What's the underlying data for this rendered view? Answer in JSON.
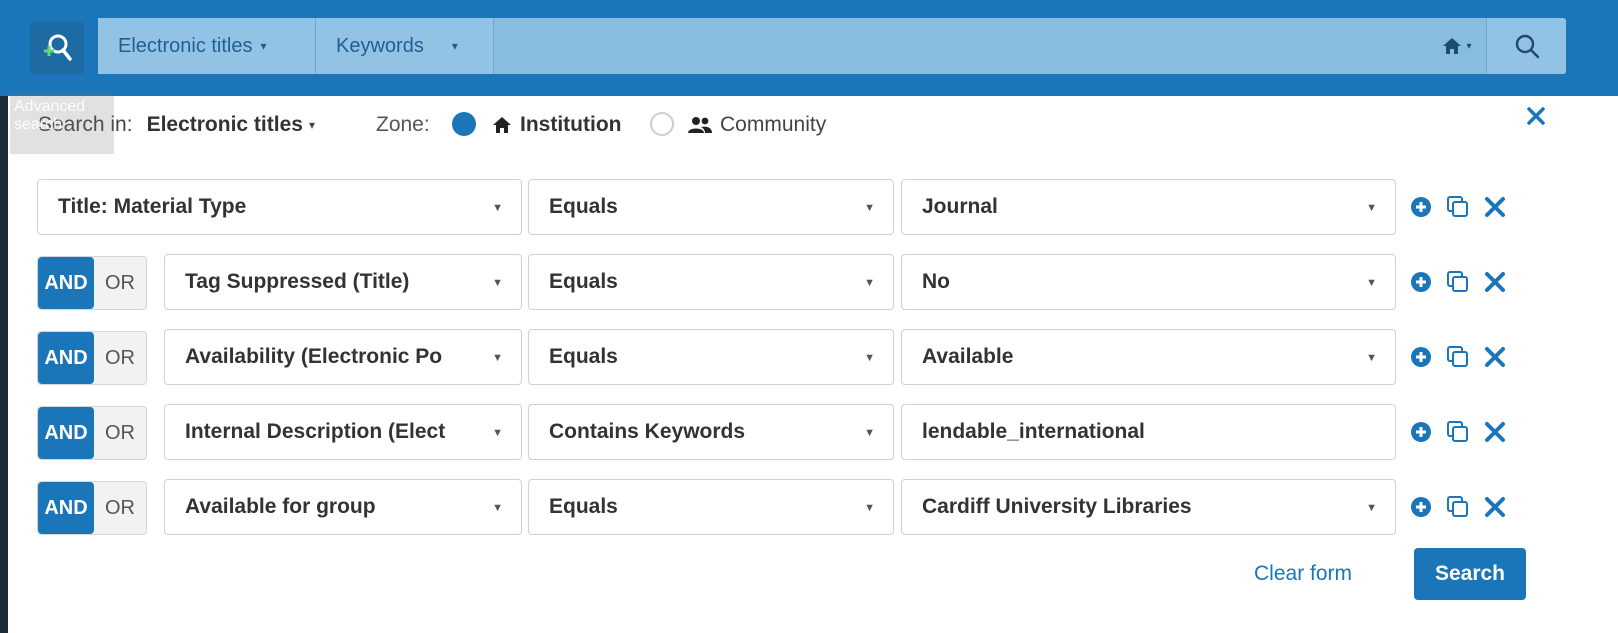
{
  "header": {
    "tooltip": "Advanced search",
    "search_type": "Electronic titles",
    "search_field": "Keywords",
    "search_type_caret": "▾",
    "search_field_caret": "▾",
    "home_caret": "▾"
  },
  "panel": {
    "search_in_label": "Search in:",
    "search_in_value": "Electronic titles",
    "zone_label": "Zone:",
    "zone_institution": "Institution",
    "zone_community": "Community",
    "zone_selected": "Institution"
  },
  "rows": [
    {
      "conj": "",
      "field": "Title: Material Type",
      "operator": "Equals",
      "value": "Journal",
      "value_dropdown": true
    },
    {
      "conj": "AND",
      "field": "Tag Suppressed (Title)",
      "operator": "Equals",
      "value": "No",
      "value_dropdown": true
    },
    {
      "conj": "AND",
      "field": "Availability (Electronic Po",
      "operator": "Equals",
      "value": "Available",
      "value_dropdown": true
    },
    {
      "conj": "AND",
      "field": "Internal Description (Elect",
      "operator": "Contains Keywords",
      "value": "lendable_international",
      "value_dropdown": false
    },
    {
      "conj": "AND",
      "field": "Available for group",
      "operator": "Equals",
      "value": "Cardiff University Libraries",
      "value_dropdown": true
    }
  ],
  "conj_labels": {
    "and": "AND",
    "or": "OR"
  },
  "actions": {
    "clear_label": "Clear form",
    "search_label": "Search"
  },
  "colors": {
    "primary": "#1a76b8",
    "strip": "#88bde0"
  }
}
